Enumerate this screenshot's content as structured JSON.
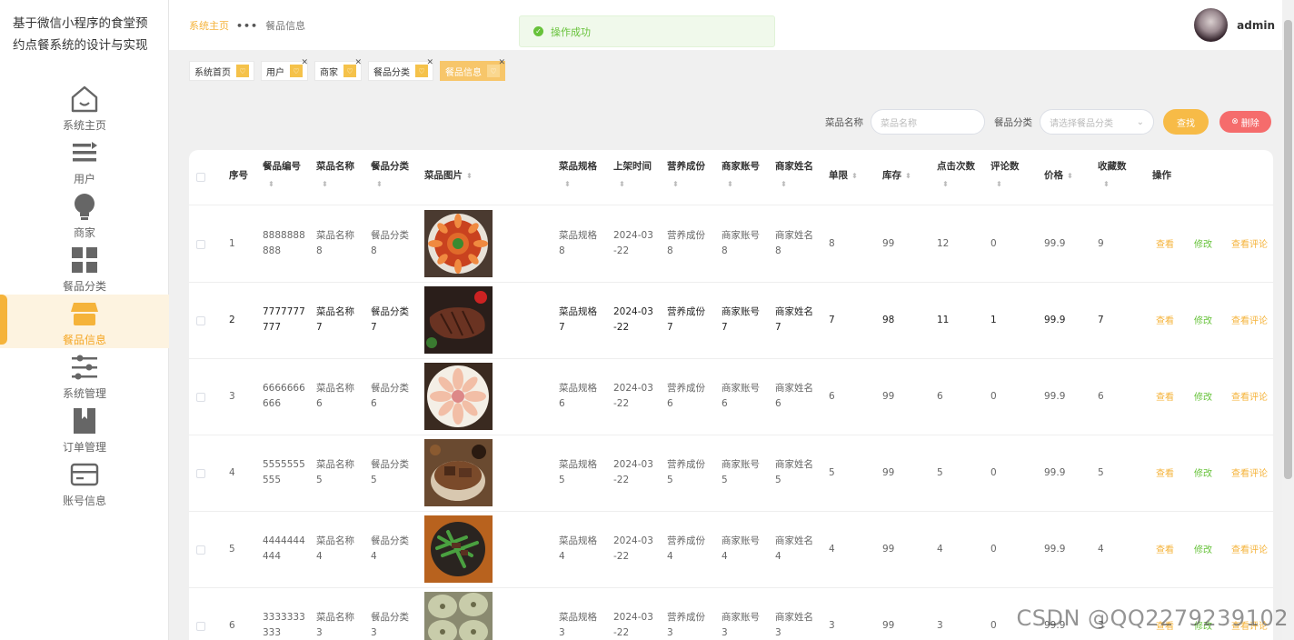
{
  "app_title": "基于微信小程序的食堂预约点餐系统的设计与实现",
  "sidebar": {
    "items": [
      {
        "label": "系统主页",
        "icon": "home-icon",
        "active": false
      },
      {
        "label": "用户",
        "icon": "list-icon",
        "active": false
      },
      {
        "label": "商家",
        "icon": "bulb-icon",
        "active": false
      },
      {
        "label": "餐品分类",
        "icon": "grid-icon",
        "active": false
      },
      {
        "label": "餐品信息",
        "icon": "shop-icon",
        "active": true
      },
      {
        "label": "系统管理",
        "icon": "sliders-icon",
        "active": false
      },
      {
        "label": "订单管理",
        "icon": "book-icon",
        "active": false
      },
      {
        "label": "账号信息",
        "icon": "card-icon",
        "active": false
      }
    ]
  },
  "breadcrumb": {
    "home": "系统主页",
    "sep": "•••",
    "current": "餐品信息"
  },
  "user": {
    "name": "admin"
  },
  "toast": {
    "text": "操作成功"
  },
  "tags": [
    {
      "label": "系统首页",
      "closable": false,
      "active": false
    },
    {
      "label": "用户",
      "closable": true,
      "active": false
    },
    {
      "label": "商家",
      "closable": true,
      "active": false
    },
    {
      "label": "餐品分类",
      "closable": true,
      "active": false
    },
    {
      "label": "餐品信息",
      "closable": true,
      "active": true
    }
  ],
  "search": {
    "name_label": "菜品名称",
    "name_placeholder": "菜品名称",
    "category_label": "餐品分类",
    "category_placeholder": "请选择餐品分类",
    "search_button": "查找",
    "delete_button": "删除"
  },
  "table": {
    "headers": {
      "index": "序号",
      "code": "餐品编号",
      "name": "菜品名称",
      "category": "餐品分类",
      "image": "菜品图片",
      "spec": "菜品规格",
      "time": "上架时间",
      "nutrition": "营养成份",
      "account": "商家账号",
      "merchant": "商家姓名",
      "limit": "单限",
      "stock": "库存",
      "clicks": "点击次数",
      "comments": "评论数",
      "price": "价格",
      "favorites": "收藏数",
      "ops": "操作"
    },
    "actions": {
      "view": "查看",
      "edit": "修改",
      "comment": "查看评论"
    },
    "rows": [
      {
        "index": "1",
        "code1": "8888888",
        "code2": "888",
        "name1": "菜品名称",
        "name2": "8",
        "cat1": "餐品分类",
        "cat2": "8",
        "spec1": "菜品规格",
        "spec2": "8",
        "time1": "2024-03",
        "time2": "-22",
        "nut1": "营养成份",
        "nut2": "8",
        "acc1": "商家账号",
        "acc2": "8",
        "mer1": "商家姓名",
        "mer2": "8",
        "limit": "8",
        "stock": "99",
        "clicks": "12",
        "comments": "0",
        "price": "99.9",
        "favorites": "9",
        "food": "shrimp"
      },
      {
        "index": "2",
        "code1": "7777777",
        "code2": "777",
        "name1": "菜品名称",
        "name2": "7",
        "cat1": "餐品分类",
        "cat2": "7",
        "spec1": "菜品规格",
        "spec2": "7",
        "time1": "2024-03",
        "time2": "-22",
        "nut1": "营养成份",
        "nut2": "7",
        "acc1": "商家账号",
        "acc2": "7",
        "mer1": "商家姓名",
        "mer2": "7",
        "limit": "7",
        "stock": "98",
        "clicks": "11",
        "comments": "1",
        "price": "99.9",
        "favorites": "7",
        "food": "steak"
      },
      {
        "index": "3",
        "code1": "6666666",
        "code2": "666",
        "name1": "菜品名称",
        "name2": "6",
        "cat1": "餐品分类",
        "cat2": "6",
        "spec1": "菜品规格",
        "spec2": "6",
        "time1": "2024-03",
        "time2": "-22",
        "nut1": "营养成份",
        "nut2": "6",
        "acc1": "商家账号",
        "acc2": "6",
        "mer1": "商家姓名",
        "mer2": "6",
        "limit": "6",
        "stock": "99",
        "clicks": "6",
        "comments": "0",
        "price": "99.9",
        "favorites": "6",
        "food": "sashimi"
      },
      {
        "index": "4",
        "code1": "5555555",
        "code2": "555",
        "name1": "菜品名称",
        "name2": "5",
        "cat1": "餐品分类",
        "cat2": "5",
        "spec1": "菜品规格",
        "spec2": "5",
        "time1": "2024-03",
        "time2": "-22",
        "nut1": "营养成份",
        "nut2": "5",
        "acc1": "商家账号",
        "acc2": "5",
        "mer1": "商家姓名",
        "mer2": "5",
        "limit": "5",
        "stock": "99",
        "clicks": "5",
        "comments": "0",
        "price": "99.9",
        "favorites": "5",
        "food": "braised"
      },
      {
        "index": "5",
        "code1": "4444444",
        "code2": "444",
        "name1": "菜品名称",
        "name2": "4",
        "cat1": "餐品分类",
        "cat2": "4",
        "spec1": "菜品规格",
        "spec2": "4",
        "time1": "2024-03",
        "time2": "-22",
        "nut1": "营养成份",
        "nut2": "4",
        "acc1": "商家账号",
        "acc2": "4",
        "mer1": "商家姓名",
        "mer2": "4",
        "limit": "4",
        "stock": "99",
        "clicks": "4",
        "comments": "0",
        "price": "99.9",
        "favorites": "4",
        "food": "greens"
      },
      {
        "index": "6",
        "code1": "3333333",
        "code2": "333",
        "name1": "菜品名称",
        "name2": "3",
        "cat1": "餐品分类",
        "cat2": "3",
        "spec1": "菜品规格",
        "spec2": "3",
        "time1": "2024-03",
        "time2": "-22",
        "nut1": "营养成份",
        "nut2": "3",
        "acc1": "商家账号",
        "acc2": "3",
        "mer1": "商家姓名",
        "mer2": "3",
        "limit": "3",
        "stock": "99",
        "clicks": "3",
        "comments": "0",
        "price": "99.9",
        "favorites": "3",
        "food": "buns"
      }
    ]
  },
  "watermark": "CSDN @QQ2279239102",
  "colors": {
    "accent": "#f5b33a",
    "success": "#67c23a",
    "danger": "#f56c6c"
  }
}
